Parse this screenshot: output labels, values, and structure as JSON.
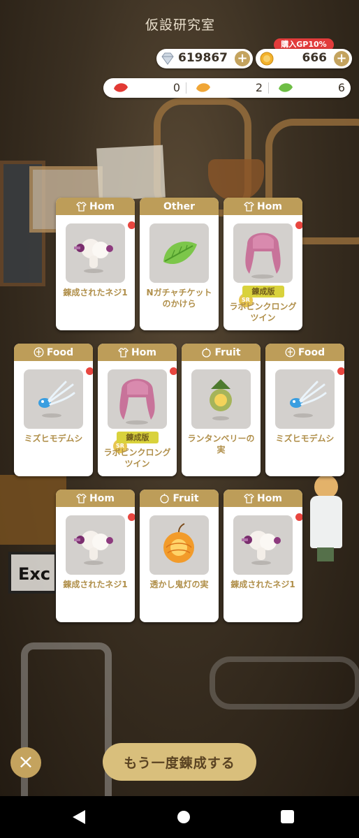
{
  "header": {
    "title": "仮設研究室"
  },
  "currency": {
    "diamond": {
      "value": "619867",
      "icon": "diamond-icon"
    },
    "coin": {
      "value": "666",
      "icon": "coin-icon",
      "badge": "購入GP10%"
    }
  },
  "leaves": [
    {
      "icon": "red-leaf-icon",
      "color": "#e23a34",
      "value": "0"
    },
    {
      "icon": "orange-leaf-icon",
      "color": "#f0a637",
      "value": "2"
    },
    {
      "icon": "green-leaf-icon",
      "color": "#6ebe45",
      "value": "6"
    }
  ],
  "cards": [
    {
      "category": "Hom",
      "cat_icon": "shirt-icon",
      "name": "錬成されたネジ1",
      "item": "screw",
      "new": true,
      "tag": "",
      "sr": false
    },
    {
      "category": "Other",
      "cat_icon": "",
      "name": "Nガチャチケットのかけら",
      "item": "leaf",
      "new": false,
      "tag": "",
      "sr": false
    },
    {
      "category": "Hom",
      "cat_icon": "shirt-icon",
      "name": "ラボピンクロングツイン",
      "item": "hair",
      "new": true,
      "tag": "錬成版",
      "sr": true,
      "sr_label": "SR"
    },
    {
      "category": "Food",
      "cat_icon": "plate-icon",
      "name": "ミズヒモデムシ",
      "item": "bug",
      "new": true,
      "tag": "",
      "sr": false
    },
    {
      "category": "Hom",
      "cat_icon": "shirt-icon",
      "name": "ラボピンクロングツイン",
      "item": "hair",
      "new": true,
      "tag": "錬成版",
      "sr": true,
      "sr_label": "SR"
    },
    {
      "category": "Fruit",
      "cat_icon": "fruit-icon",
      "name": "ランタンベリーの実",
      "item": "berry",
      "new": false,
      "tag": "",
      "sr": false
    },
    {
      "category": "Food",
      "cat_icon": "plate-icon",
      "name": "ミズヒモデムシ",
      "item": "bug",
      "new": true,
      "tag": "",
      "sr": false
    },
    {
      "category": "Hom",
      "cat_icon": "shirt-icon",
      "name": "錬成されたネジ1",
      "item": "screw",
      "new": true,
      "tag": "",
      "sr": false
    },
    {
      "category": "Fruit",
      "cat_icon": "fruit-icon",
      "name": "透かし鬼灯の実",
      "item": "lantern",
      "new": false,
      "tag": "",
      "sr": false
    },
    {
      "category": "Hom",
      "cat_icon": "shirt-icon",
      "name": "錬成されたネジ1",
      "item": "screw",
      "new": true,
      "tag": "",
      "sr": false
    }
  ],
  "buttons": {
    "close": "×",
    "again": "もう一度錬成する"
  },
  "sign_text": "Exc",
  "colors": {
    "accent": "#bd9d59",
    "new_dot": "#e8463f"
  }
}
